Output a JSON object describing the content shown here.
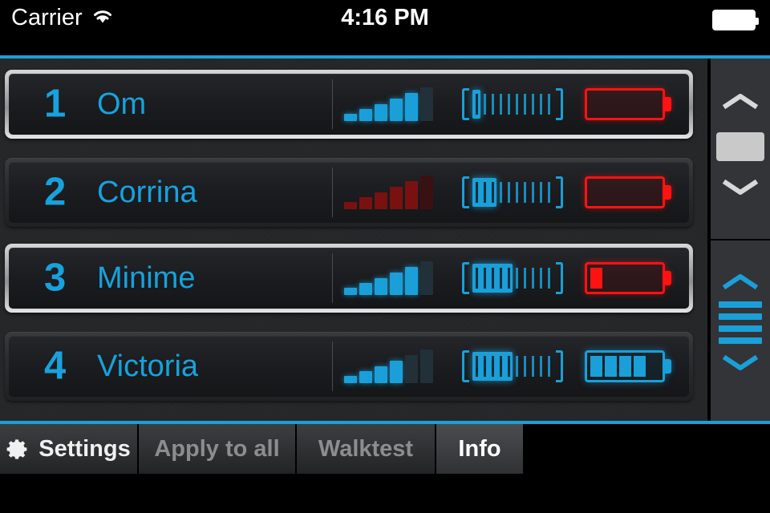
{
  "status_bar": {
    "carrier": "Carrier",
    "wifi_icon": "wifi-icon",
    "time": "4:16 PM",
    "battery_icon": "battery-full-icon"
  },
  "theme": {
    "accent_cyan": "#1b9fd8",
    "text_cyan": "#17a2dd",
    "alert_red": "#ff1212",
    "dim_red": "#7a1111",
    "panel_bg": "#262729",
    "row_bg": "#1b1d20",
    "sidebar_bg": "#333437"
  },
  "devices": [
    {
      "number": "1",
      "name": "Om",
      "selected": true,
      "signal": {
        "bars_total": 6,
        "bars_on": 5,
        "state": "online"
      },
      "volume": {
        "segments_total": 10,
        "segments_on": 1
      },
      "battery": {
        "cells_total": 5,
        "cells_on": 0,
        "state": "critical",
        "color": "#ff1212"
      }
    },
    {
      "number": "2",
      "name": "Corrina",
      "selected": false,
      "signal": {
        "bars_total": 6,
        "bars_on": 5,
        "state": "offline"
      },
      "volume": {
        "segments_total": 10,
        "segments_on": 3
      },
      "battery": {
        "cells_total": 5,
        "cells_on": 0,
        "state": "critical",
        "color": "#ff1212"
      }
    },
    {
      "number": "3",
      "name": "Minime",
      "selected": true,
      "signal": {
        "bars_total": 6,
        "bars_on": 5,
        "state": "online"
      },
      "volume": {
        "segments_total": 10,
        "segments_on": 5
      },
      "battery": {
        "cells_total": 5,
        "cells_on": 1,
        "state": "low",
        "color": "#ff1212"
      }
    },
    {
      "number": "4",
      "name": "Victoria",
      "selected": false,
      "signal": {
        "bars_total": 6,
        "bars_on": 4,
        "state": "online"
      },
      "volume": {
        "segments_total": 10,
        "segments_on": 5
      },
      "battery": {
        "cells_total": 5,
        "cells_on": 4,
        "state": "good",
        "color": "#1b9fd8"
      }
    }
  ],
  "sidebar": {
    "scroll_section": {
      "up_icon": "chevron-up-icon",
      "thumb": "scroll-thumb",
      "down_icon": "chevron-down-icon"
    },
    "level_section": {
      "up_icon": "chevron-up-icon",
      "bars": 4,
      "down_icon": "chevron-down-icon"
    }
  },
  "toolbar": {
    "buttons": [
      {
        "label": "Settings",
        "icon": "gear-icon",
        "style": "bright",
        "width_class": "tb-w1"
      },
      {
        "label": "Apply to all",
        "icon": null,
        "style": "dim",
        "width_class": "tb-w2"
      },
      {
        "label": "Walktest",
        "icon": null,
        "style": "dim",
        "width_class": "tb-w3"
      },
      {
        "label": "Info",
        "icon": null,
        "style": "active",
        "width_class": "tb-w4"
      }
    ]
  }
}
